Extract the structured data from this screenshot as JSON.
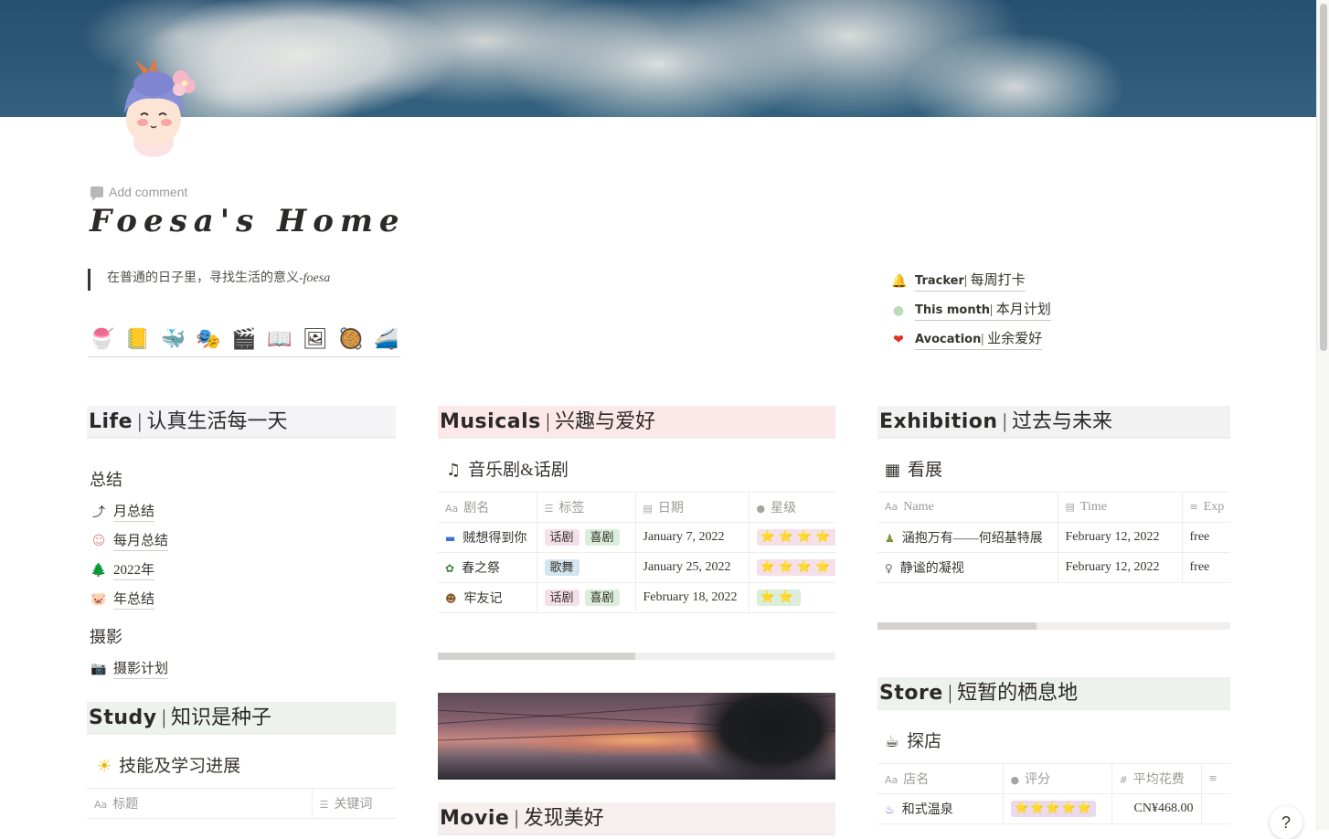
{
  "page": {
    "add_comment": "Add comment",
    "title": "Foesa's Home",
    "quote_main": "在普通的日子里，寻找生活的意义-",
    "quote_sign": "foesa",
    "icon_row": [
      "🍧",
      "📒",
      "🐳",
      "🎭",
      "🎬",
      "📖",
      "🖼",
      "🥘",
      "🚄"
    ]
  },
  "quick_links": [
    {
      "icon": "🔔",
      "en": "Tracker",
      "zh": "| 每周打卡"
    },
    {
      "icon": "●",
      "en": "This month",
      "zh": "| 本月计划"
    },
    {
      "icon": "❤",
      "en": "Avocation",
      "zh": "| 业余爱好"
    }
  ],
  "life": {
    "header_en": "Life",
    "header_zh": "| 认真生活每一天",
    "group1": "总结",
    "items1": [
      {
        "icon": "⤴",
        "label": "月总结"
      },
      {
        "icon": "☺",
        "label": "每月总结"
      },
      {
        "icon": "🌲",
        "label": "2022年"
      },
      {
        "icon": "🐷",
        "label": "年总结"
      }
    ],
    "group2": "摄影",
    "items2": [
      {
        "icon": "📷",
        "label": "摄影计划"
      }
    ]
  },
  "study": {
    "header_en": "Study",
    "header_zh": "| 知识是种子",
    "sub_title": "技能及学习进展",
    "columns": [
      "标题",
      "关键词"
    ]
  },
  "musicals": {
    "header_en": "Musicals",
    "header_zh": "| 兴趣与爱好",
    "sub_title": "音乐剧&话剧",
    "columns": [
      "剧名",
      "标签",
      "日期",
      "星级"
    ],
    "rows": [
      {
        "icon": "▬",
        "name": "贼想得到你",
        "tags": [
          "话剧",
          "喜剧"
        ],
        "date": "January 7, 2022",
        "stars": "⭐⭐⭐⭐"
      },
      {
        "icon": "✿",
        "name": "春之祭",
        "tags": [
          "歌舞"
        ],
        "date": "January 25, 2022",
        "stars": "⭐⭐⭐⭐"
      },
      {
        "icon": "☻",
        "name": "牢友记",
        "tags": [
          "话剧",
          "喜剧"
        ],
        "date": "February 18, 2022",
        "stars": "⭐⭐"
      }
    ]
  },
  "movie": {
    "header_en": "Movie",
    "header_zh": "| 发现美好"
  },
  "exhibition": {
    "header_en": "Exhibition",
    "header_zh": "| 过去与未来",
    "sub_title": "看展",
    "columns": [
      "Name",
      "Time",
      "Exp"
    ],
    "rows": [
      {
        "icon": "♟",
        "name": "涵抱万有——何绍基特展",
        "time": "February 12, 2022",
        "exp": "free"
      },
      {
        "icon": "♀",
        "name": "静谧的凝视",
        "time": "February 12, 2022",
        "exp": "free"
      }
    ]
  },
  "store": {
    "header_en": "Store",
    "header_zh": "| 短暂的栖息地",
    "sub_title": "探店",
    "columns": [
      "店名",
      "评分",
      "平均花费"
    ],
    "rows": [
      {
        "icon": "♨",
        "name": "和式温泉",
        "rating": "⭐⭐⭐⭐⭐",
        "cost": "CN¥468.00"
      }
    ]
  },
  "help_label": "?",
  "colors": {
    "life_header_bg": "#f4f4f6",
    "study_header_bg": "#edf2ec",
    "musicals_header_bg": "#fce8e8",
    "movie_header_bg": "#f7eeee",
    "exhibition_header_bg": "#f2f2f3",
    "store_header_bg": "#edf2ec"
  }
}
